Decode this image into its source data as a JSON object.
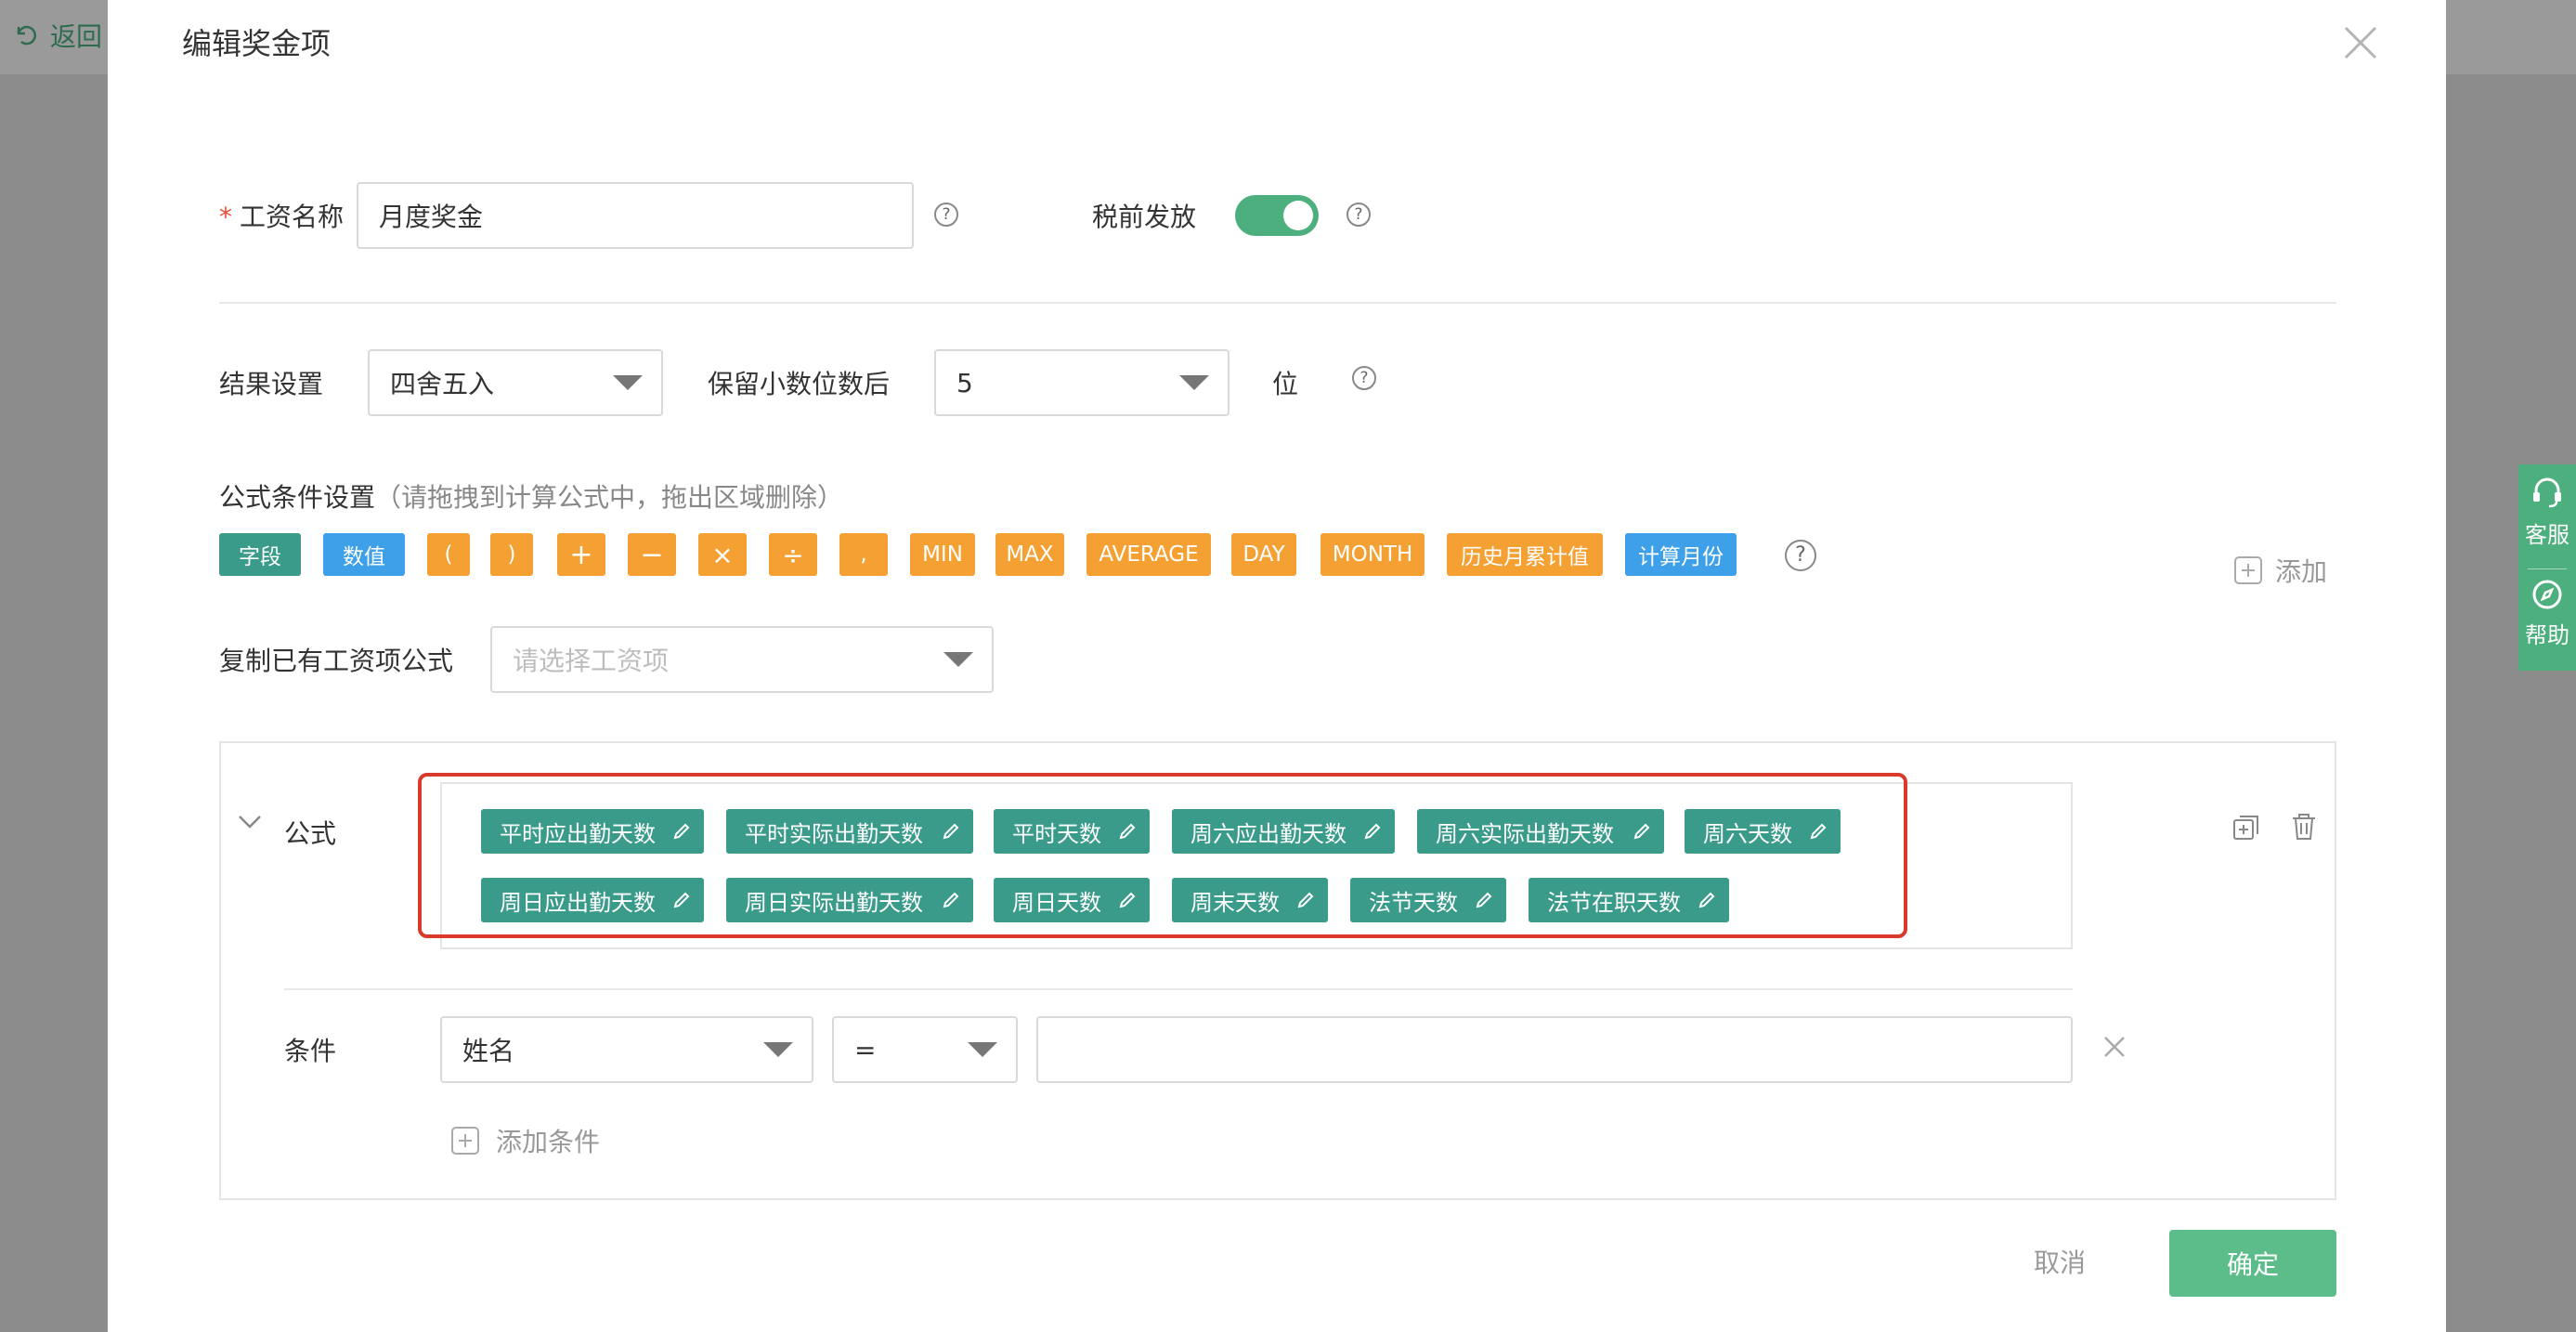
{
  "background": {
    "back_label": "返回"
  },
  "modal": {
    "title": "编辑奖金项",
    "name_label": "工资名称",
    "name_value": "月度奖金",
    "tax_label": "税前发放",
    "tax_enabled": true,
    "result_label": "结果设置",
    "result_value": "四舍五入",
    "decimal_label": "保留小数位数后",
    "decimal_value": "5",
    "decimal_unit": "位",
    "formula_cond_label": "公式条件设置",
    "formula_cond_hint": "（请拖拽到计算公式中，拖出区域删除）",
    "chips": [
      {
        "label": "字段",
        "color": "#3a9b8a"
      },
      {
        "label": "数值",
        "color": "#3da0e8"
      },
      {
        "label": "(",
        "color": "#f5a033"
      },
      {
        "label": ")",
        "color": "#f5a033"
      },
      {
        "label": "+",
        "color": "#f5a033"
      },
      {
        "label": "−",
        "color": "#f5a033"
      },
      {
        "label": "×",
        "color": "#f5a033"
      },
      {
        "label": "÷",
        "color": "#f5a033"
      },
      {
        "label": ",",
        "color": "#f5a033"
      },
      {
        "label": "MIN",
        "color": "#f5a033"
      },
      {
        "label": "MAX",
        "color": "#f5a033"
      },
      {
        "label": "AVERAGE",
        "color": "#f5a033"
      },
      {
        "label": "DAY",
        "color": "#f5a033"
      },
      {
        "label": "MONTH",
        "color": "#f5a033"
      },
      {
        "label": "历史月累计值",
        "color": "#f5a033"
      },
      {
        "label": "计算月份",
        "color": "#3da0e8"
      }
    ],
    "add_label": "添加",
    "copy_label": "复制已有工资项公式",
    "copy_placeholder": "请选择工资项",
    "formula_label": "公式",
    "formula_tags": [
      "平时应出勤天数",
      "平时实际出勤天数",
      "平时天数",
      "周六应出勤天数",
      "周六实际出勤天数",
      "周六天数",
      "周日应出勤天数",
      "周日实际出勤天数",
      "周日天数",
      "周末天数",
      "法节天数",
      "法节在职天数"
    ],
    "condition_label": "条件",
    "condition_field": "姓名",
    "condition_op": "=",
    "condition_value": "",
    "add_condition_label": "添加条件",
    "cancel_label": "取消",
    "ok_label": "确定"
  },
  "side_panel": {
    "service_label": "客服",
    "help_label": "帮助"
  },
  "colors": {
    "primary": "#5cbd8a",
    "teal": "#3a9b8a",
    "orange": "#f5a033",
    "blue": "#3da0e8",
    "highlight": "#d93a2b"
  }
}
